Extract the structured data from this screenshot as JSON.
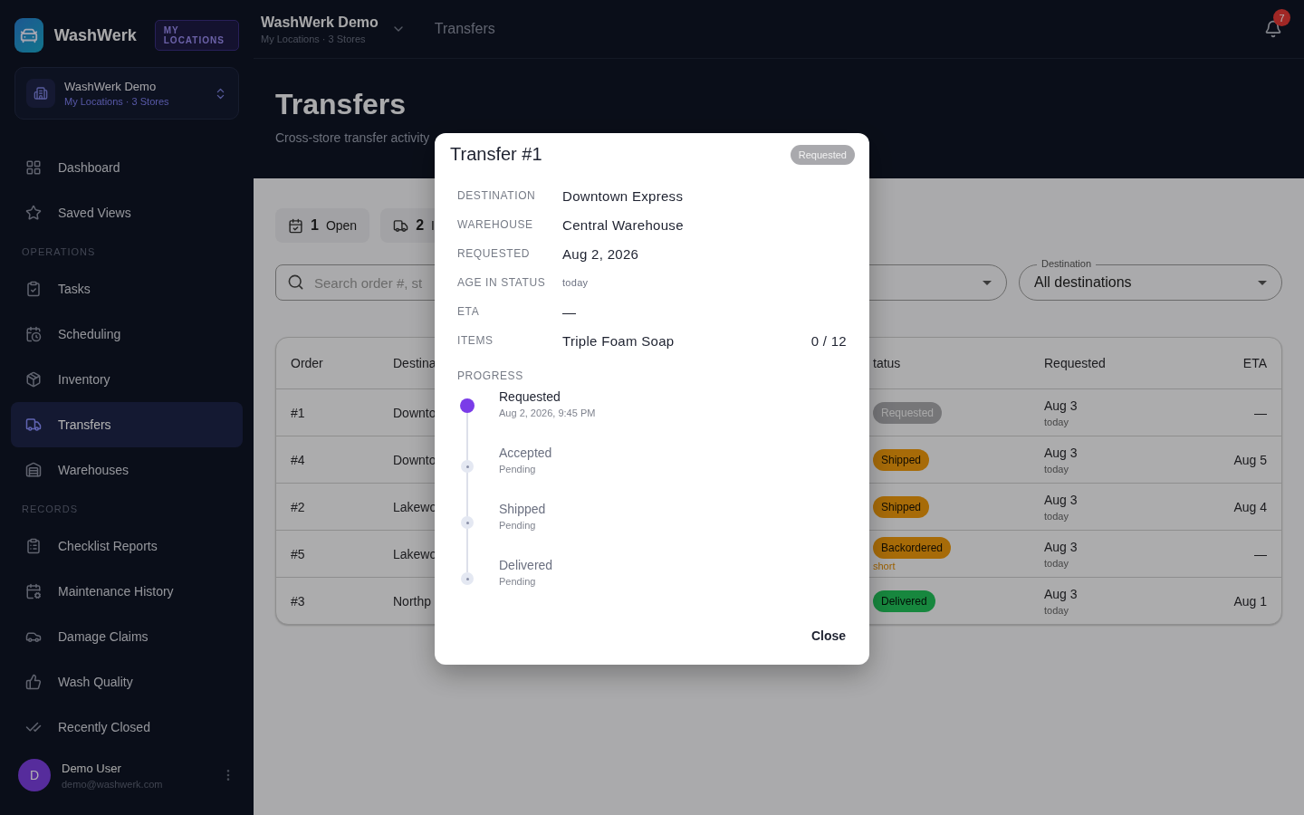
{
  "sidebar": {
    "brand": "WashWerk",
    "brand_badge": "MY LOCATIONS",
    "org": {
      "name": "WashWerk Demo",
      "sub": "My Locations · 3 Stores"
    },
    "groups": [
      {
        "items": [
          {
            "label": "Dashboard",
            "selected": false
          },
          {
            "label": "Saved Views",
            "selected": false
          }
        ]
      },
      {
        "heading": "OPERATIONS",
        "items": [
          {
            "label": "Tasks",
            "selected": false
          },
          {
            "label": "Scheduling",
            "selected": false
          },
          {
            "label": "Inventory",
            "selected": false
          },
          {
            "label": "Transfers",
            "selected": true
          },
          {
            "label": "Warehouses",
            "selected": false
          }
        ]
      },
      {
        "heading": "RECORDS",
        "items": [
          {
            "label": "Checklist Reports",
            "selected": false
          },
          {
            "label": "Maintenance History",
            "selected": false
          },
          {
            "label": "Damage Claims",
            "selected": false
          },
          {
            "label": "Wash Quality",
            "selected": false
          },
          {
            "label": "Recently Closed",
            "selected": false
          }
        ]
      }
    ],
    "user": {
      "initial": "D",
      "name": "Demo User",
      "email": "demo@washwerk.com"
    }
  },
  "topbar": {
    "org": "WashWerk Demo",
    "org_sub": "My Locations · 3 Stores",
    "crumb": "Transfers",
    "notifications": "7"
  },
  "page": {
    "title": "Transfers",
    "subtitle": "Cross-store transfer activity"
  },
  "chips": [
    {
      "count": "1",
      "label": "Open"
    },
    {
      "count": "2",
      "label": "I"
    }
  ],
  "filters": {
    "search_placeholder": "Search order #, st",
    "destination_label": "Destination",
    "destination_value": "All destinations"
  },
  "table": {
    "columns": [
      "Order",
      "Destina",
      "tatus",
      "Requested",
      "ETA"
    ],
    "rows": [
      {
        "order": "#1",
        "destination": "Downto",
        "status": {
          "label": "Requested",
          "kind": "requested"
        },
        "requested": "Aug 3",
        "requested_sub": "today",
        "eta": "—"
      },
      {
        "order": "#4",
        "destination": "Downto",
        "status": {
          "label": "Shipped",
          "kind": "shipped"
        },
        "requested": "Aug 3",
        "requested_sub": "today",
        "eta": "Aug 5"
      },
      {
        "order": "#2",
        "destination": "Lakewo",
        "status": {
          "label": "Shipped",
          "kind": "shipped"
        },
        "requested": "Aug 3",
        "requested_sub": "today",
        "eta": "Aug 4"
      },
      {
        "order": "#5",
        "destination": "Lakewo",
        "status": {
          "label": "Backordered",
          "kind": "backordered",
          "note": "short"
        },
        "requested": "Aug 3",
        "requested_sub": "today",
        "eta": "—"
      },
      {
        "order": "#3",
        "destination": "Northp",
        "status": {
          "label": "Delivered",
          "kind": "delivered"
        },
        "requested": "Aug 3",
        "requested_sub": "today",
        "eta": "Aug 1"
      }
    ]
  },
  "modal": {
    "title": "Transfer #1",
    "status": {
      "label": "Requested",
      "kind": "requested"
    },
    "fields": [
      {
        "label": "DESTINATION",
        "value": "Downtown Express",
        "kind": "text"
      },
      {
        "label": "WAREHOUSE",
        "value": "Central Warehouse",
        "kind": "text"
      },
      {
        "label": "REQUESTED",
        "value": "Aug 2, 2026",
        "kind": "text"
      },
      {
        "label": "AGE IN STATUS",
        "value": "today",
        "kind": "muted"
      },
      {
        "label": "ETA",
        "value": "—",
        "kind": "text"
      },
      {
        "label": "ITEMS",
        "value": "Triple Foam Soap",
        "kind": "text",
        "qty": "0 / 12"
      }
    ],
    "progress_label": "PROGRESS",
    "steps": [
      {
        "label": "Requested",
        "sub": "Aug 2, 2026, 9:45 PM",
        "done": true
      },
      {
        "label": "Accepted",
        "sub": "Pending",
        "done": false
      },
      {
        "label": "Shipped",
        "sub": "Pending",
        "done": false
      },
      {
        "label": "Delivered",
        "sub": "Pending",
        "done": false
      }
    ],
    "close": "Close"
  }
}
